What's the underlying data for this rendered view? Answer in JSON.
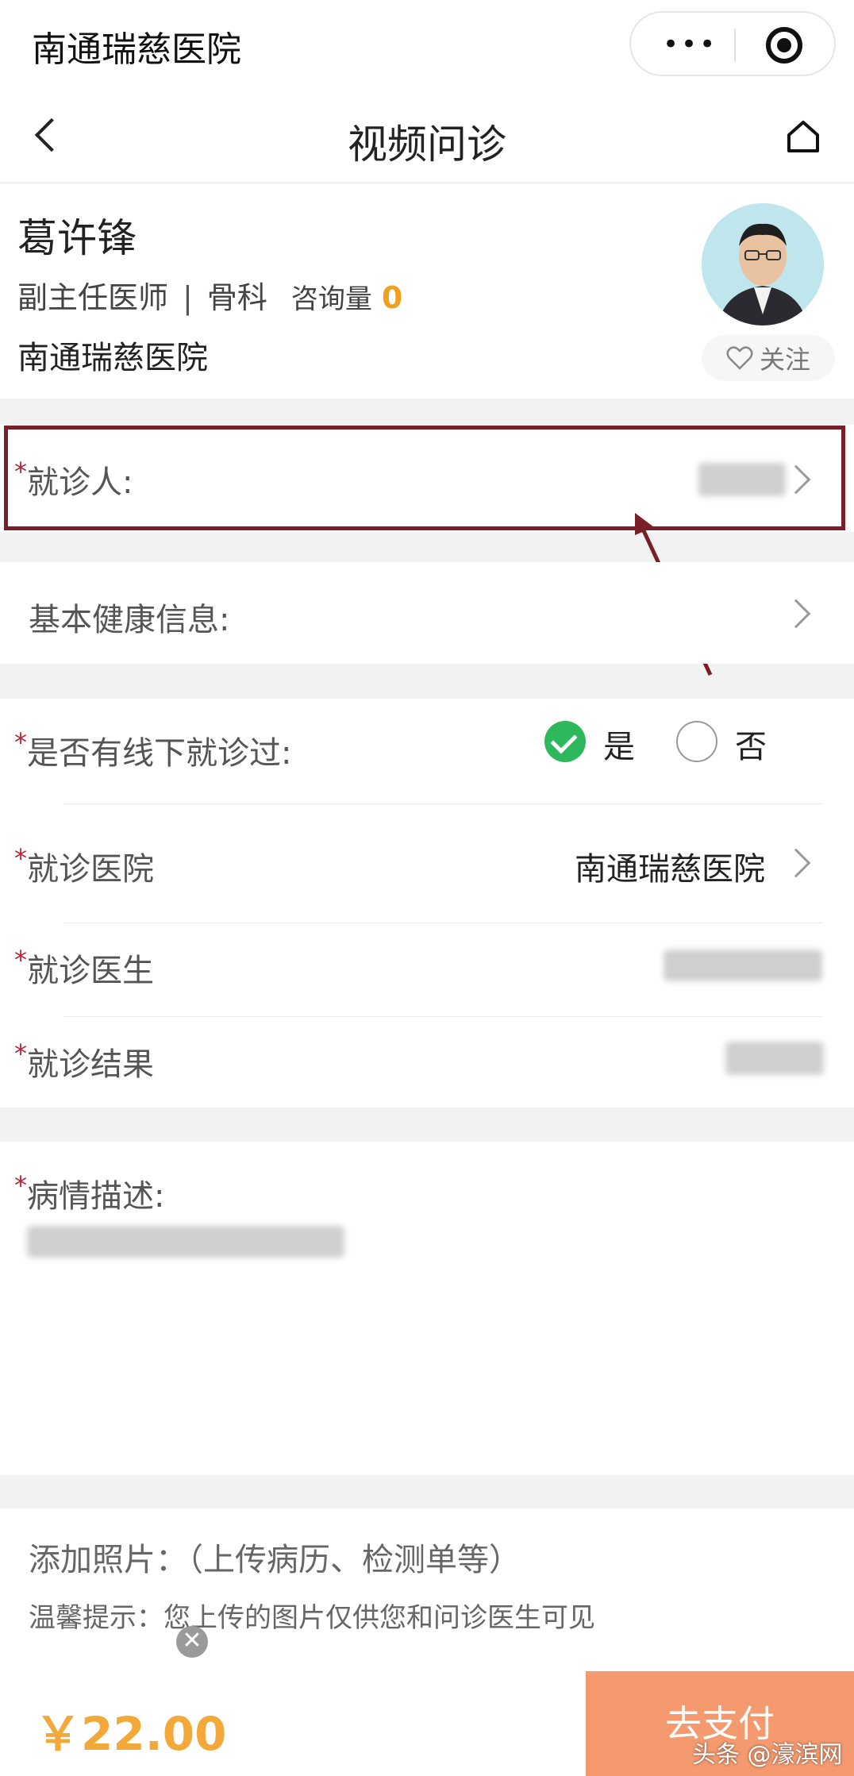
{
  "app": {
    "title": "南通瑞慈医院",
    "menu_icon": "more-dots-icon",
    "close_icon": "target-icon"
  },
  "nav": {
    "title": "视频问诊",
    "back_icon": "chevron-left-icon",
    "home_icon": "home-icon"
  },
  "doctor": {
    "name": "葛许锋",
    "title": "副主任医师",
    "separator": "|",
    "department": "骨科",
    "consult_label": "咨询量",
    "consult_count": "0",
    "hospital": "南通瑞慈医院",
    "follow_label": "关注"
  },
  "form": {
    "required_mark": "*",
    "patient_label": "就诊人:",
    "health_label": "基本健康信息:",
    "offline_label": "是否有线下就诊过:",
    "yes_label": "是",
    "no_label": "否",
    "offline_selected": "是",
    "hospital_label": "就诊医院",
    "hospital_value": "南通瑞慈医院",
    "doctor_label": "就诊医生",
    "result_label": "就诊结果",
    "description_label": "病情描述:"
  },
  "photos": {
    "title": "添加照片：（上传病历、检测单等）",
    "tip": "温馨提示：您上传的图片仅供您和问诊医生可见",
    "remove_icon": "close-icon"
  },
  "payment": {
    "price": "￥22.00",
    "pay_label": "去支付"
  },
  "watermark": "头条 @濠滨网",
  "colors": {
    "accent_price": "#f3a83a",
    "pay_button": "#f49a6e",
    "required": "#b0263b",
    "radio_on": "#2eb85c",
    "highlight": "#7a1f28"
  }
}
